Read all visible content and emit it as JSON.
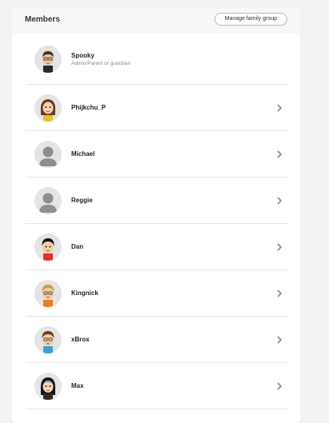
{
  "header": {
    "title": "Members",
    "manage_button": "Manage family group"
  },
  "members": [
    {
      "name": "Spooky",
      "role": "Admin/Parent or guardian",
      "avatar": "mii-spooky-icon"
    },
    {
      "name": "Phijkchu_P",
      "role": "",
      "avatar": "mii-phijkchu-icon"
    },
    {
      "name": "Michael",
      "role": "",
      "avatar": "default-user-icon"
    },
    {
      "name": "Reggie",
      "role": "",
      "avatar": "default-user-icon"
    },
    {
      "name": "Dan",
      "role": "",
      "avatar": "mii-dan-icon"
    },
    {
      "name": "Kingnick",
      "role": "",
      "avatar": "mii-kingnick-icon"
    },
    {
      "name": "xBrox",
      "role": "",
      "avatar": "mii-xbrox-icon"
    },
    {
      "name": "Max",
      "role": "",
      "avatar": "mii-max-icon"
    }
  ],
  "colors": {
    "background": "#f2f2f2",
    "card": "#ffffff",
    "divider": "#e6e6e6",
    "chevron": "#9a9a9a"
  }
}
